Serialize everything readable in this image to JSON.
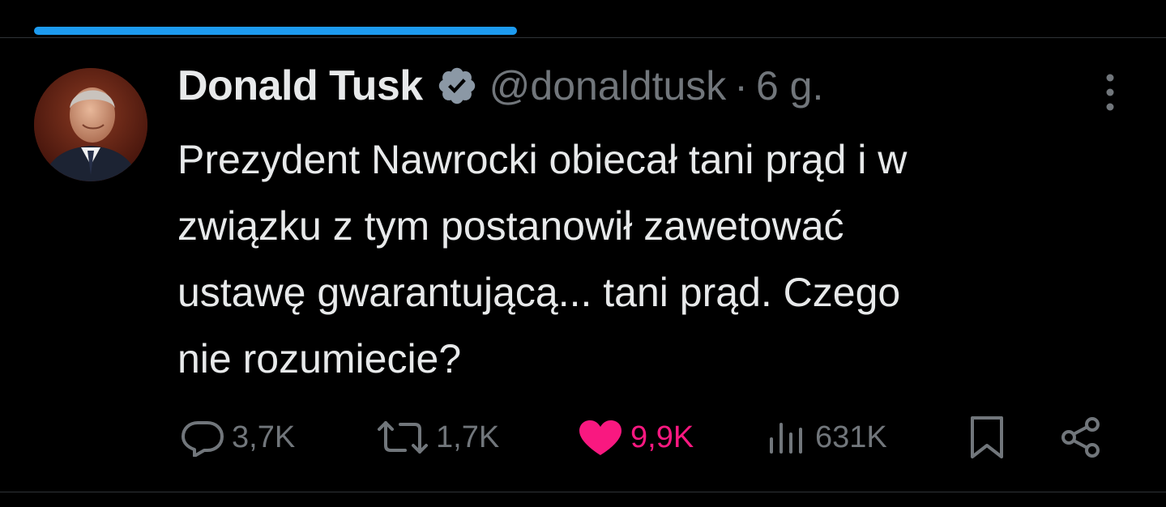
{
  "tweet": {
    "author_name": "Donald Tusk",
    "handle": "@donaldtusk",
    "separator": "·",
    "timestamp": "6 g.",
    "text": "Prezydent Nawrocki obiecał tani prąd i w\nzwiązku z tym postanowił zawetować\nustawę gwarantującą... tani prąd. Czego\nnie rozumiecie?",
    "verified": true,
    "avatar_icon": "profile-photo"
  },
  "actions": {
    "replies": {
      "icon": "reply-bubble-icon",
      "count": "3,7K"
    },
    "reposts": {
      "icon": "repost-icon",
      "count": "1,7K"
    },
    "likes": {
      "icon": "heart-icon",
      "count": "9,9K",
      "active": true
    },
    "views": {
      "icon": "views-bar-icon",
      "count": "631K"
    },
    "bookmark": {
      "icon": "bookmark-icon"
    },
    "share": {
      "icon": "share-icon"
    }
  },
  "colors": {
    "background": "#000000",
    "text_primary": "#e7e9ea",
    "text_secondary": "#71767b",
    "accent_blue": "#1d9bf0",
    "like_pink": "#f91880",
    "divider": "#2f3336"
  }
}
